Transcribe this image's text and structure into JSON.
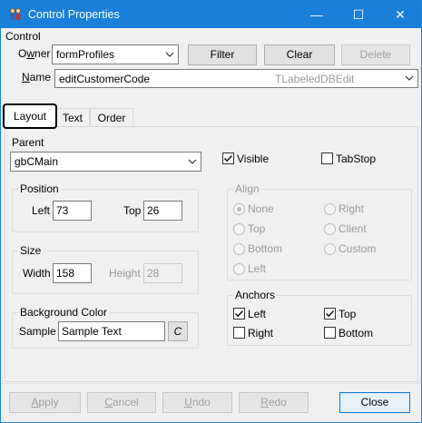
{
  "window": {
    "title": "Control Properties",
    "minimize": "—",
    "maximize": "☐",
    "close": "✕"
  },
  "control": {
    "section_label": "Control",
    "owner_label_pre": "O",
    "owner_label_u": "w",
    "owner_label_post": "ner",
    "owner_value": "formProfiles",
    "filter_label": "Filter",
    "clear_label": "Clear",
    "delete_label": "Delete",
    "name_label_u": "N",
    "name_label_post": "ame",
    "name_value": "editCustomerCode",
    "name_type": "TLabeledDBEdit"
  },
  "tabs": [
    {
      "label": "Layout",
      "active": true
    },
    {
      "label": "Text",
      "active": false
    },
    {
      "label": "Order",
      "active": false
    }
  ],
  "layout": {
    "parent_label": "Parent",
    "parent_value": "gbCMain",
    "visible_label": "Visible",
    "visible_checked": true,
    "tabstop_label": "TabStop",
    "tabstop_checked": false,
    "position": {
      "title": "Position",
      "left_label": "Left",
      "left_value": "73",
      "top_label": "Top",
      "top_value": "26"
    },
    "size": {
      "title": "Size",
      "width_label": "Width",
      "width_value": "158",
      "height_label": "Height",
      "height_value": "28"
    },
    "background": {
      "title": "Background Color",
      "sample_label": "Sample",
      "sample_value": "Sample Text",
      "color_button": "C"
    },
    "align": {
      "title": "Align",
      "options": [
        "None",
        "Right",
        "Top",
        "Client",
        "Bottom",
        "Custom",
        "Left"
      ],
      "selected": "None"
    },
    "anchors": {
      "title": "Anchors",
      "left_label": "Left",
      "left_checked": true,
      "top_label": "Top",
      "top_checked": true,
      "right_label": "Right",
      "right_checked": false,
      "bottom_label": "Bottom",
      "bottom_checked": false
    }
  },
  "footer": {
    "apply_u": "A",
    "apply_rest": "pply",
    "cancel_u": "C",
    "cancel_rest": "ancel",
    "undo_u": "U",
    "undo_rest": "ndo",
    "redo_u": "R",
    "redo_rest": "edo",
    "close_label": "Close"
  },
  "icons": {
    "app_icon": "people-icon",
    "dropdown_icon": "chevron-down-icon",
    "check_icon": "checkmark-icon"
  },
  "colors": {
    "titlebar": "#1a7fd8",
    "window_bg": "#f0f0f0",
    "default_button_border": "#0078d7"
  }
}
